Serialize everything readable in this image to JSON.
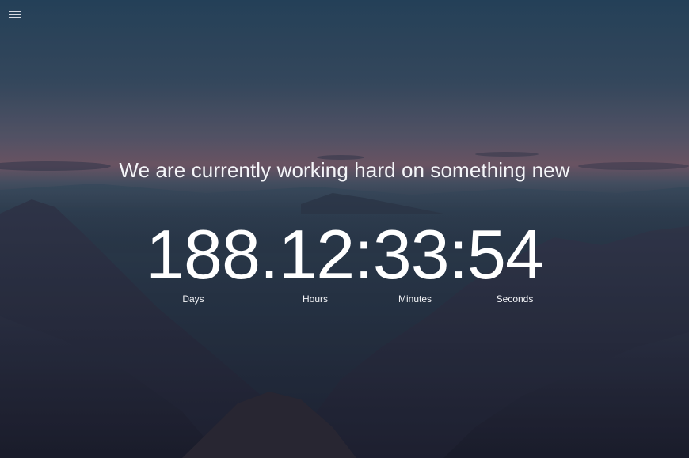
{
  "header": {
    "menu_icon": "hamburger-menu-icon"
  },
  "main": {
    "headline": "We are currently working hard on something new",
    "countdown": {
      "display": "188.12:33:54",
      "days": "188",
      "hours": "12",
      "minutes": "33",
      "seconds": "54",
      "labels": {
        "days": "Days",
        "hours": "Hours",
        "minutes": "Minutes",
        "seconds": "Seconds"
      }
    }
  },
  "colors": {
    "text": "#ffffff",
    "sky_top": "#2d4a63",
    "horizon": "#7a5a6a",
    "mountains": "#252a3b"
  }
}
